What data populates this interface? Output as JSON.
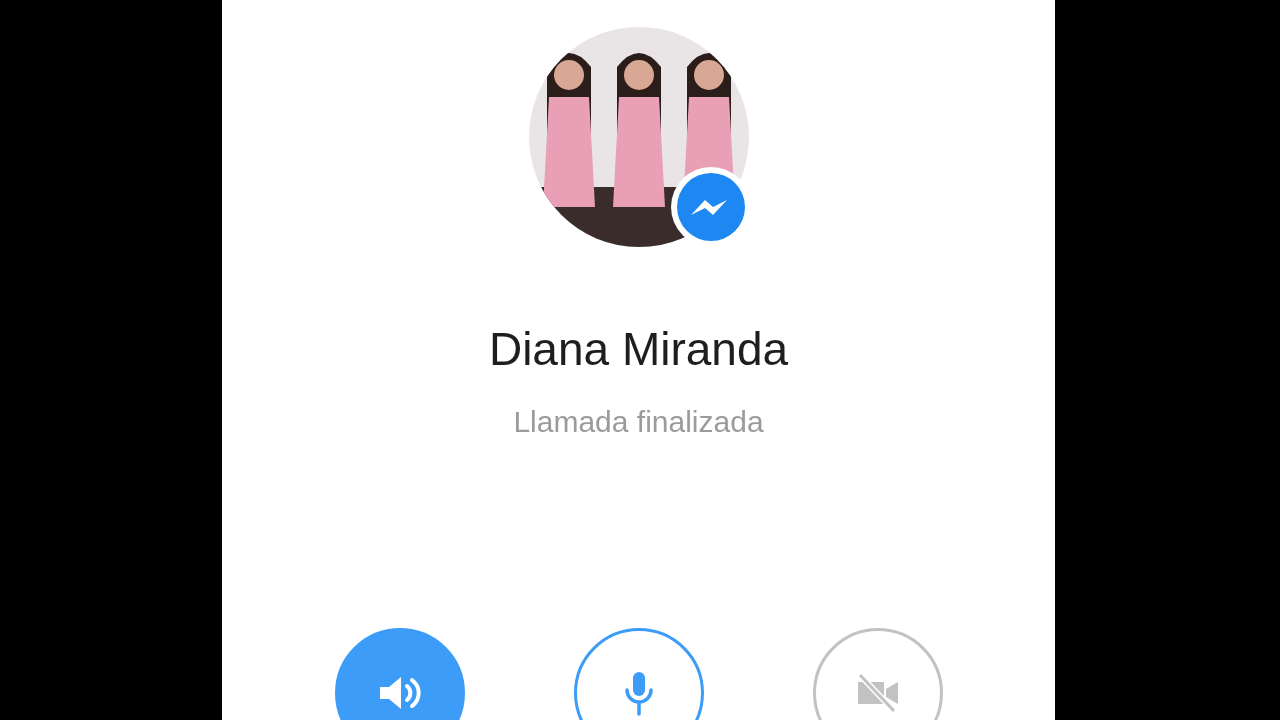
{
  "contact": {
    "name": "Diana Miranda",
    "status": "Llamada finalizada"
  },
  "controls": [
    {
      "kind": "speaker",
      "on": true,
      "disabled": false
    },
    {
      "kind": "microphone",
      "on": false,
      "disabled": false
    },
    {
      "kind": "video",
      "disabled": true
    }
  ]
}
